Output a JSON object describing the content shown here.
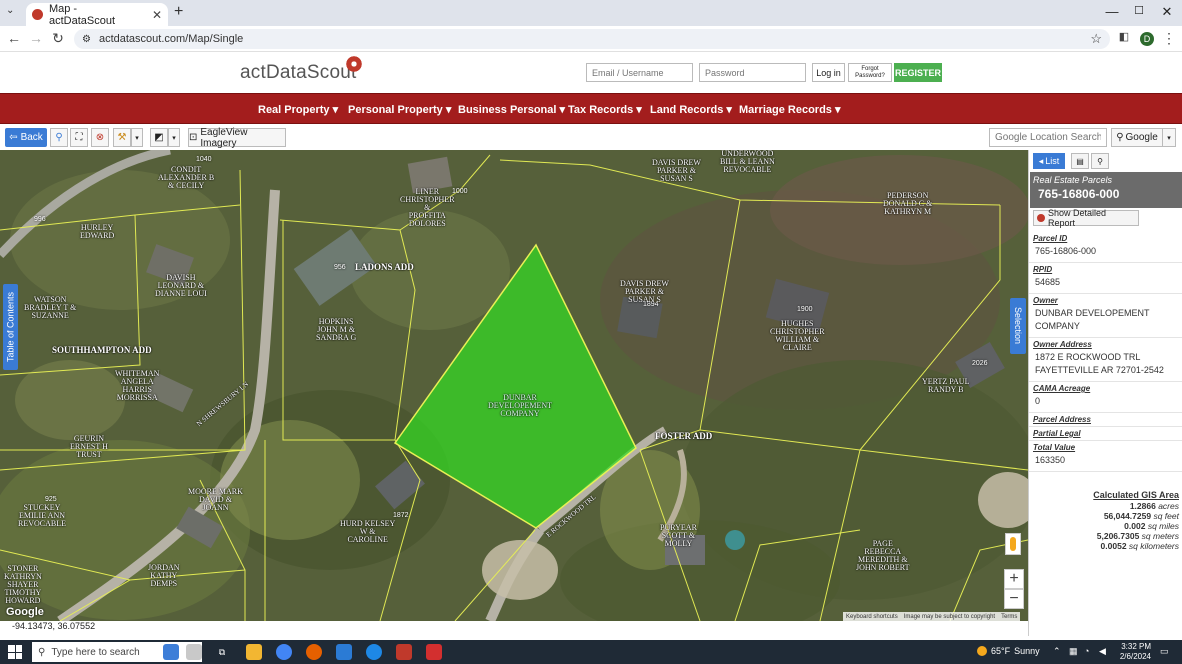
{
  "browser": {
    "tab_title": "Map - actDataScout",
    "tab_close": "✕",
    "new_tab": "+",
    "url": "actdatascout.com/Map/Single",
    "profile_initial": "D",
    "window_controls": [
      "—",
      "☐",
      "✕"
    ]
  },
  "header": {
    "logo_text": "actDataScout",
    "email_placeholder": "Email / Username",
    "password_placeholder": "Password",
    "login_label": "Log in",
    "forgot_label": "Forgot Password?",
    "register_label": "REGISTER"
  },
  "nav": {
    "items": [
      {
        "label": "Real Property"
      },
      {
        "label": "Personal Property"
      },
      {
        "label": "Business Personal"
      },
      {
        "label": "Tax Records"
      },
      {
        "label": "Land Records"
      },
      {
        "label": "Marriage Records"
      }
    ]
  },
  "map_toolbar": {
    "back_label": "Back",
    "eagleview_label": "EagleView Imagery",
    "search_placeholder": "Google Location Search",
    "google_label": "Google"
  },
  "map": {
    "toc_label": "Table of Contents",
    "selection_label": "Selection",
    "zoom_in": "+",
    "zoom_out": "−",
    "google_logo": "Google",
    "attribution": [
      "Keyboard shortcuts",
      "Image may be subject to copyright",
      "Terms"
    ],
    "coordinates": "-94.13473, 36.07552",
    "subdivisions": [
      "LADONS ADD",
      "SOUTHHAMPTON ADD",
      "FOSTER ADD"
    ],
    "street_labels": [
      "N SHREWSBURY LN",
      "E ROCKWOOD TRL"
    ],
    "house_numbers": [
      "1040",
      "996",
      "1000",
      "956",
      "1894",
      "1900",
      "2026",
      "925",
      "1872"
    ],
    "owner_labels": [
      "CONDIT\nALEXANDER B\n& CECILY",
      "HURLEY\nEDWARD",
      "LINER\nCHRISTOPHER\n&\nPROFFITA\nDOLORES",
      "UNDERWOOD\nBILL & LEANN\nREVOCABLE",
      "DAVIS DREW\nPARKER &\nSUSAN S",
      "PEDERSON\nDONALD C &\nKATHRYN M",
      "DAVISH\nLEONARD &\nDIANNE LOUI",
      "WATSON\nBRADLEY T &\nSUZANNE",
      "HOPKINS\nJOHN M &\nSANDRA G",
      "DAVIS DREW\nPARKER &\nSUSAN S",
      "HUGHES\nCHRISTOPHER\nWILLIAM &\nCLAIRE",
      "WHITEMAN\nANGELA\nHARRIS\nMORRISSA",
      "DUNBAR\nDEVELOPEMENT\nCOMPANY",
      "YERTZ PAUL\nRANDY B",
      "GEURIN\nERNEST H\nTRUST",
      "MOORE MARK\nDAVID &\nJOANN",
      "STUCKEY\nEMILIE ANN\nREVOCABLE",
      "HURD KELSEY\nW &\nCAROLINE",
      "PURYEAR\nSCOTT &\nMOLLY",
      "PAGE\nREBECCA\nMEREDITH &\nJOHN ROBERT",
      "STONER\nKATHRYN\nSHAYER\nTIMOTHY\nHOWARD",
      "JORDAN\nKATHY\nDEMPS"
    ]
  },
  "panel": {
    "list_label": "List",
    "layer_title": "Real Estate Parcels",
    "parcel_id_header": "765-16806-000",
    "report_label": "Show Detailed Report",
    "fields": [
      {
        "label": "Parcel ID",
        "value": "765-16806-000"
      },
      {
        "label": "RPID",
        "value": "54685"
      },
      {
        "label": "Owner",
        "value": "DUNBAR DEVELOPEMENT COMPANY"
      },
      {
        "label": "Owner Address",
        "value": "1872 E ROCKWOOD TRL FAYETTEVILLE AR 72701-2542"
      },
      {
        "label": "CAMA Acreage",
        "value": "0"
      },
      {
        "label": "Parcel Address",
        "value": ""
      },
      {
        "label": "Partial Legal",
        "value": ""
      },
      {
        "label": "Total Value",
        "value": "163350"
      }
    ],
    "gis": {
      "title": "Calculated GIS Area",
      "rows": [
        {
          "value": "1.2866",
          "unit": "acres"
        },
        {
          "value": "56,044.7259",
          "unit": "sq feet"
        },
        {
          "value": "0.002",
          "unit": "sq miles"
        },
        {
          "value": "5,206.7305",
          "unit": "sq meters"
        },
        {
          "value": "0.0052",
          "unit": "sq kilometers"
        }
      ]
    }
  },
  "taskbar": {
    "search_placeholder": "Type here to search",
    "weather_temp": "65°F",
    "weather_desc": "Sunny",
    "time": "3:32 PM",
    "date": "2/6/2024"
  },
  "colors": {
    "nav_bg": "#a31d1d",
    "accent_blue": "#3a7bd5",
    "register_green": "#4caf50",
    "parcel_fill": "#33dd22",
    "parcel_line": "#e8f055"
  }
}
